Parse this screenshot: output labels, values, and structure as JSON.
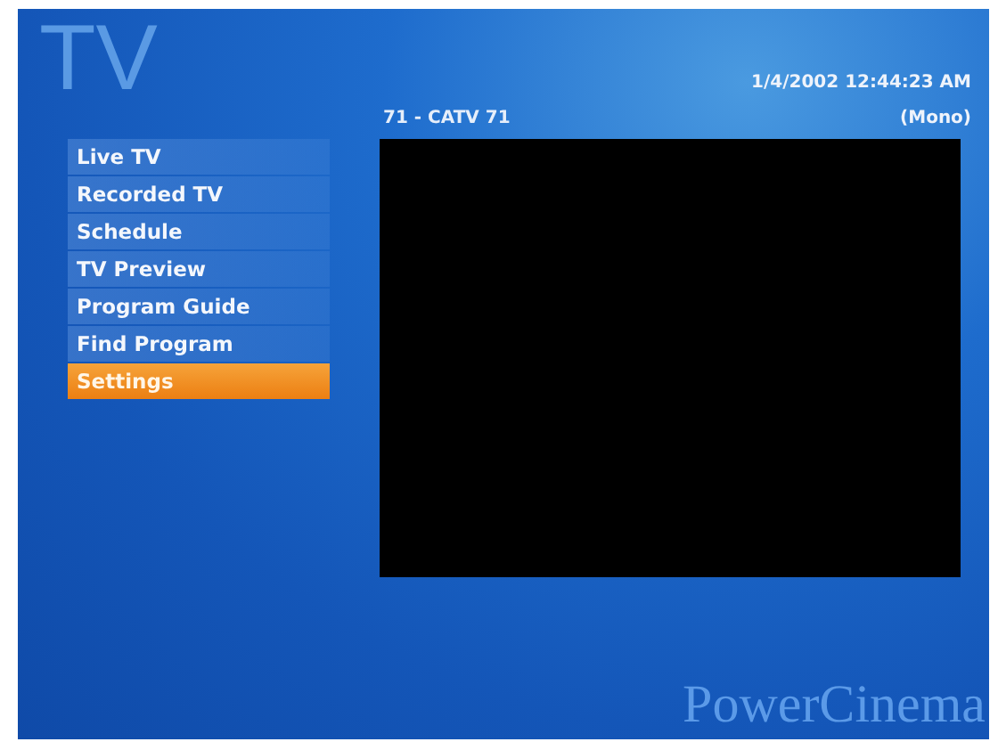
{
  "section_title": "TV",
  "channel": "71 - CATV 71",
  "datetime": "1/4/2002 12:44:23 AM",
  "audio_mode": "(Mono)",
  "menu": [
    {
      "label": "Live TV",
      "selected": false
    },
    {
      "label": "Recorded TV",
      "selected": false
    },
    {
      "label": "Schedule",
      "selected": false
    },
    {
      "label": "TV Preview",
      "selected": false
    },
    {
      "label": "Program Guide",
      "selected": false
    },
    {
      "label": "Find Program",
      "selected": false
    },
    {
      "label": "Settings",
      "selected": true
    }
  ],
  "brand": "PowerCinema"
}
